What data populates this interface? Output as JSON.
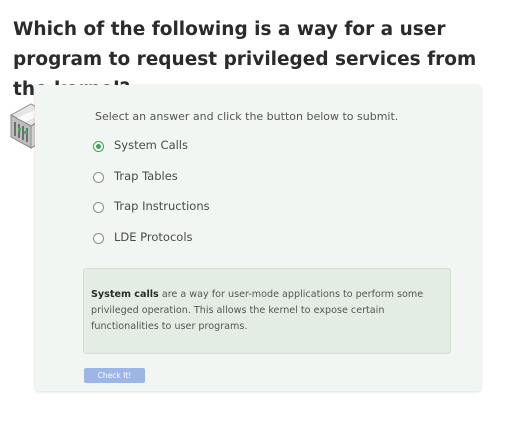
{
  "question": "Which of the following is a way for a user program to request privileged services from the kernel?",
  "quiz": {
    "instruction": "Select an answer and click the button below to submit.",
    "options": [
      {
        "label": "System Calls",
        "selected": true
      },
      {
        "label": "Trap Tables",
        "selected": false
      },
      {
        "label": "Trap Instructions",
        "selected": false
      },
      {
        "label": "LDE Protocols",
        "selected": false
      }
    ],
    "feedback": {
      "term": "System calls",
      "text": " are a way for user-mode applications to perform some privileged operation. This allows the kernel to expose certain functionalities to user programs."
    },
    "check_button_label": "Check It!"
  },
  "colors": {
    "card_background": "#f2f6f2",
    "feedback_background": "#e3ede3",
    "selected_radio": "#3aa35a",
    "button_background": "#9cb7e6"
  },
  "icons": {
    "quiz_icon": "server-rack-icon"
  }
}
